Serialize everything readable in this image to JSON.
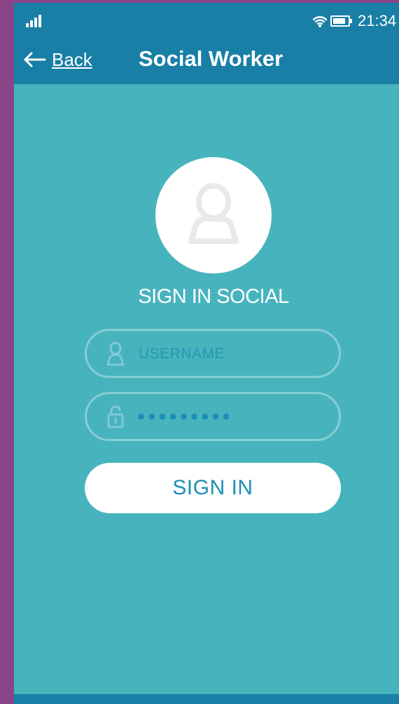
{
  "status_bar": {
    "time": "21:34",
    "icons": [
      "signal-icon",
      "wifi-icon",
      "battery-icon"
    ]
  },
  "header": {
    "back_label": "Back",
    "title": "Social Worker"
  },
  "login": {
    "title": "SIGN IN SOCIAL",
    "username_placeholder": "USERNAME",
    "password_mask": "•••••••••",
    "signin_label": "SIGN IN"
  },
  "icons": {
    "back": "back-arrow-icon",
    "avatar": "user-avatar-icon",
    "username": "user-icon",
    "password": "lock-icon"
  },
  "colors": {
    "header_blue": "#197fa6",
    "page_teal": "#47b3bd",
    "surround_purple": "#8a4589",
    "button_white": "#ffffff",
    "input_text_blue": "#229ab3"
  }
}
